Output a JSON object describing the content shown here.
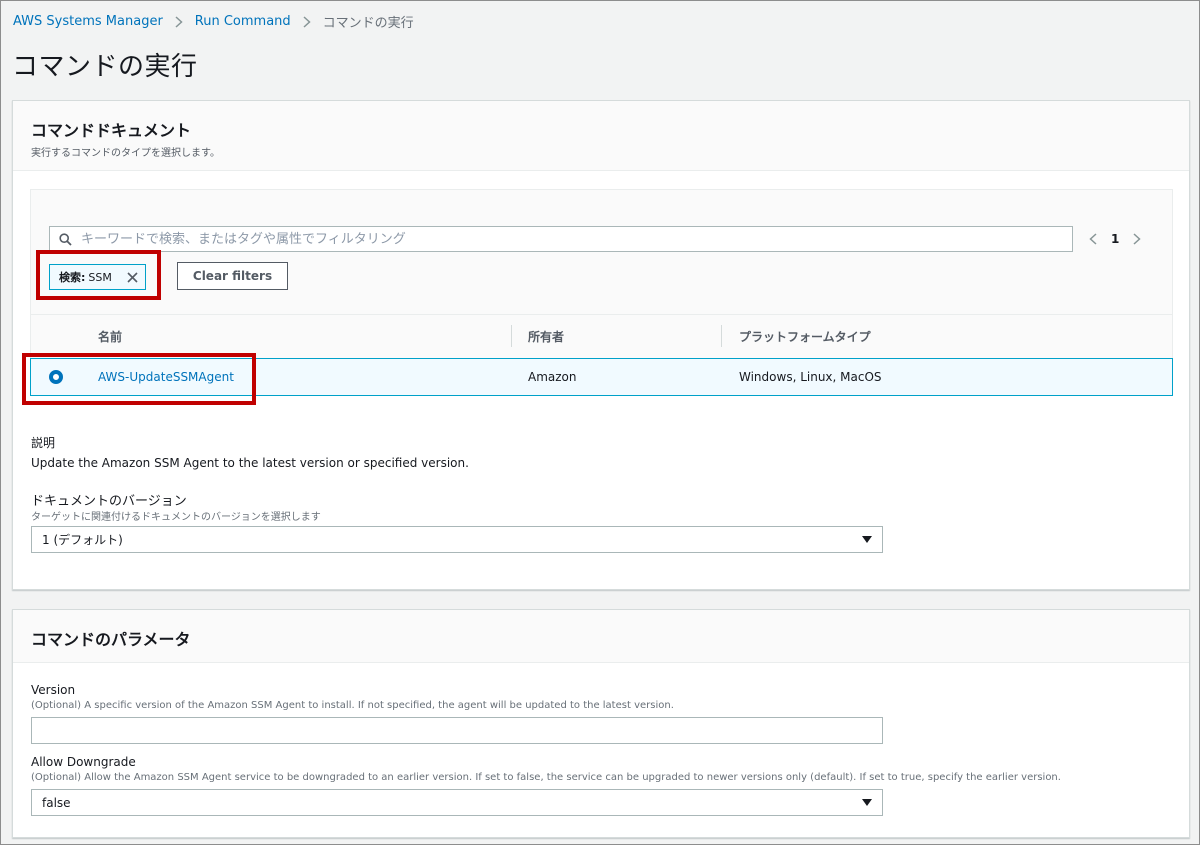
{
  "breadcrumb": {
    "items": [
      "AWS Systems Manager",
      "Run Command",
      "コマンドの実行"
    ]
  },
  "page_title": "コマンドの実行",
  "command_document": {
    "title": "コマンドドキュメント",
    "description": "実行するコマンドのタイプを選択します。",
    "search": {
      "placeholder": "キーワードで検索、またはタグや属性でフィルタリング",
      "value": ""
    },
    "pagination": {
      "current_page": "1"
    },
    "filter_token": {
      "label": "検索:",
      "value": "SSM"
    },
    "clear_filters_label": "Clear filters",
    "table": {
      "columns": [
        "名前",
        "所有者",
        "プラットフォームタイプ"
      ],
      "rows": [
        {
          "name": "AWS-UpdateSSMAgent",
          "owner": "Amazon",
          "platform": "Windows, Linux, MacOS",
          "selected": true
        }
      ]
    },
    "explanation_label": "説明",
    "explanation_text": "Update the Amazon SSM Agent to the latest version or specified version.",
    "version_label": "ドキュメントのバージョン",
    "version_desc": "ターゲットに関連付けるドキュメントのバージョンを選択します",
    "version_value": "1 (デフォルト)"
  },
  "command_parameters": {
    "title": "コマンドのパラメータ",
    "version_field": {
      "label": "Version",
      "description": "(Optional) A specific version of the Amazon SSM Agent to install. If not specified, the agent will be updated to the latest version.",
      "value": ""
    },
    "downgrade_field": {
      "label": "Allow Downgrade",
      "description": "(Optional) Allow the Amazon SSM Agent service to be downgraded to an earlier version. If set to false, the service can be upgraded to newer versions only (default). If set to true, specify the earlier version.",
      "value": "false"
    }
  },
  "colors": {
    "link": "#0073bb",
    "selected_border": "#00a1c9",
    "selected_bg": "#f1faff",
    "annotation_highlight": "#c00000",
    "page_bg": "#f2f3f3"
  }
}
